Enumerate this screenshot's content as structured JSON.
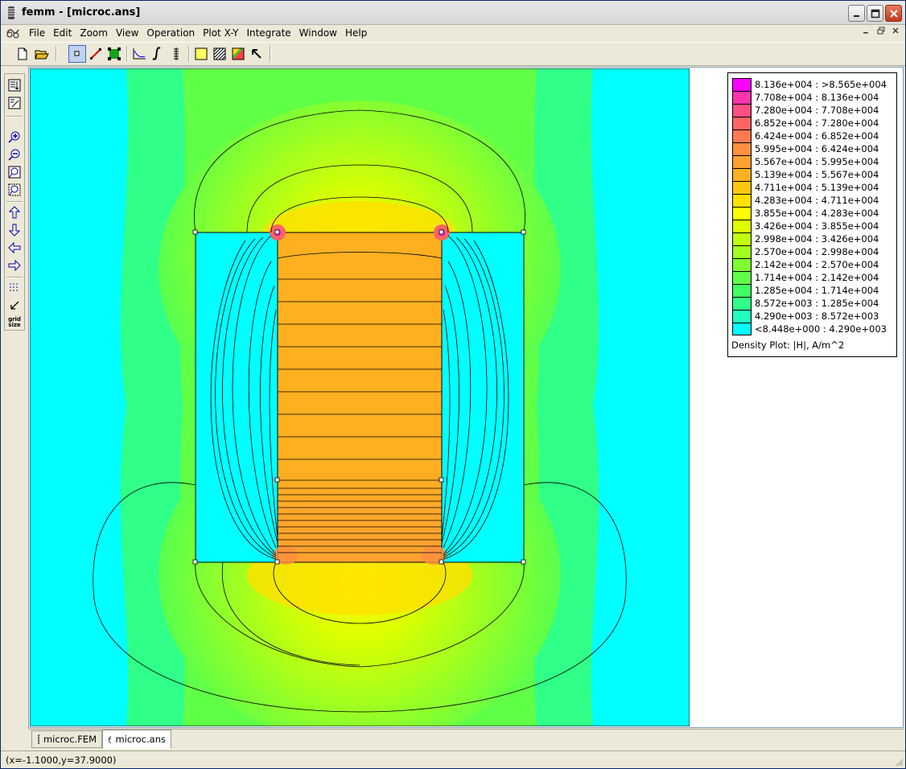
{
  "window": {
    "title": "femm - [microc.ans]"
  },
  "menu": {
    "items": [
      "File",
      "Edit",
      "Zoom",
      "View",
      "Operation",
      "Plot X-Y",
      "Integrate",
      "Window",
      "Help"
    ]
  },
  "toolbar": {
    "buttons": [
      "new-file-icon",
      "open-file-icon",
      "select-node-icon",
      "select-segment-icon",
      "select-block-icon",
      "plot-xy-icon",
      "integrate-icon",
      "line-integral-icon",
      "contour-plot-icon",
      "density-plot-icon",
      "vector-plot-icon",
      "pointer-icon"
    ]
  },
  "left_toolbar": {
    "buttons": [
      "show-mesh-icon",
      "edit-icon",
      "zoom-in-icon",
      "zoom-out-icon",
      "zoom-natural-icon",
      "zoom-window-icon",
      "pan-up-icon",
      "pan-down-icon",
      "pan-left-icon",
      "pan-right-icon",
      "show-grid-icon",
      "snap-grid-icon"
    ],
    "grid_size_label": "grid size"
  },
  "legend": {
    "entries": [
      {
        "label": "8.136e+004 : >8.565e+004",
        "color": "#ff00ff"
      },
      {
        "label": "7.708e+004 : 8.136e+004",
        "color": "#ff33aa"
      },
      {
        "label": "7.280e+004 : 7.708e+004",
        "color": "#ff4f80"
      },
      {
        "label": "6.852e+004 : 7.280e+004",
        "color": "#ff6464"
      },
      {
        "label": "6.424e+004 : 6.852e+004",
        "color": "#ff7a50"
      },
      {
        "label": "5.995e+004 : 6.424e+004",
        "color": "#ff9040"
      },
      {
        "label": "5.567e+004 : 5.995e+004",
        "color": "#ffa030"
      },
      {
        "label": "5.139e+004 : 5.567e+004",
        "color": "#ffb020"
      },
      {
        "label": "4.711e+004 : 5.139e+004",
        "color": "#ffc810"
      },
      {
        "label": "4.283e+004 : 4.711e+004",
        "color": "#ffe000"
      },
      {
        "label": "3.855e+004 : 4.283e+004",
        "color": "#ffff00"
      },
      {
        "label": "3.426e+004 : 3.855e+004",
        "color": "#ddff00"
      },
      {
        "label": "2.998e+004 : 3.426e+004",
        "color": "#c0ff10"
      },
      {
        "label": "2.570e+004 : 2.998e+004",
        "color": "#a0ff20"
      },
      {
        "label": "2.142e+004 : 2.570e+004",
        "color": "#80ff30"
      },
      {
        "label": "1.714e+004 : 2.142e+004",
        "color": "#60ff48"
      },
      {
        "label": "1.285e+004 : 1.714e+004",
        "color": "#40ff60"
      },
      {
        "label": "8.572e+003 : 1.285e+004",
        "color": "#30ff88"
      },
      {
        "label": "4.290e+003 : 8.572e+003",
        "color": "#20ffc0"
      },
      {
        "label": "<8.448e+000 : 4.290e+003",
        "color": "#00ffff"
      }
    ],
    "title": "Density Plot: |H|, A/m^2"
  },
  "tabs": [
    {
      "label": "microc.FEM",
      "active": false
    },
    {
      "label": "microc.ans",
      "active": true
    }
  ],
  "status": {
    "coords": "(x=-1.1000,y=37.9000)"
  }
}
